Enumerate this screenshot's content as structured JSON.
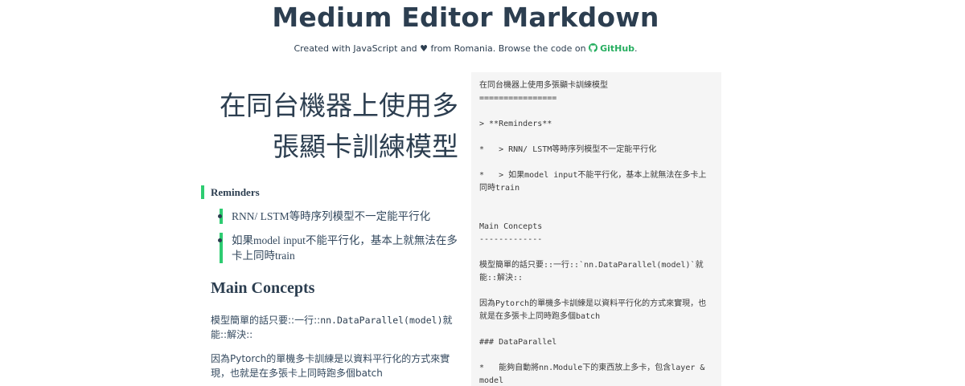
{
  "header": {
    "title": "Medium Editor Markdown",
    "subtitle_prefix": "Created with JavaScript and",
    "subtitle_middle": "from Romania. Browse the code on",
    "github_label": "GitHub",
    "subtitle_suffix": ".",
    "heart_icon": "heart-icon",
    "github_icon": "github-icon",
    "link_color": "#27ae60"
  },
  "preview": {
    "title": "在同台機器上使用多張顯卡訓練模型",
    "quote_title": "Reminders",
    "quote_items": [
      "RNN/ LSTM等時序列模型不一定能平行化",
      "如果model input不能平行化，基本上就無法在多卡上同時train"
    ],
    "section_heading": "Main Concepts",
    "para1_prefix": "模型簡單的話只要::一行::",
    "para1_code": "nn.DataParallel(model)",
    "para1_suffix": "就能::解決::",
    "para2": "因為Pytorch的單機多卡訓練是以資料平行化的方式來實現，也就是在多張卡上同時跑多個batch",
    "accent_color": "#2ecc71"
  },
  "editor": {
    "markdown": "在同台機器上使用多張顯卡訓練模型\n================\n\n> **Reminders**\n\n*   > RNN/ LSTM等時序列模型不一定能平行化\n\n*   > 如果model input不能平行化，基本上就無法在多卡上同時train\n\n\nMain Concepts\n-------------\n\n模型簡單的話只要::一行::`nn.DataParallel(model)`就能::解決::\n\n因為Pytorch的單機多卡訓練是以資料平行化的方式來實現，也就是在多張卡上同時跑多個batch\n\n### DataParallel\n\n*   能夠自動將nn.Module下的東西放上多卡，包含layer & model"
  }
}
